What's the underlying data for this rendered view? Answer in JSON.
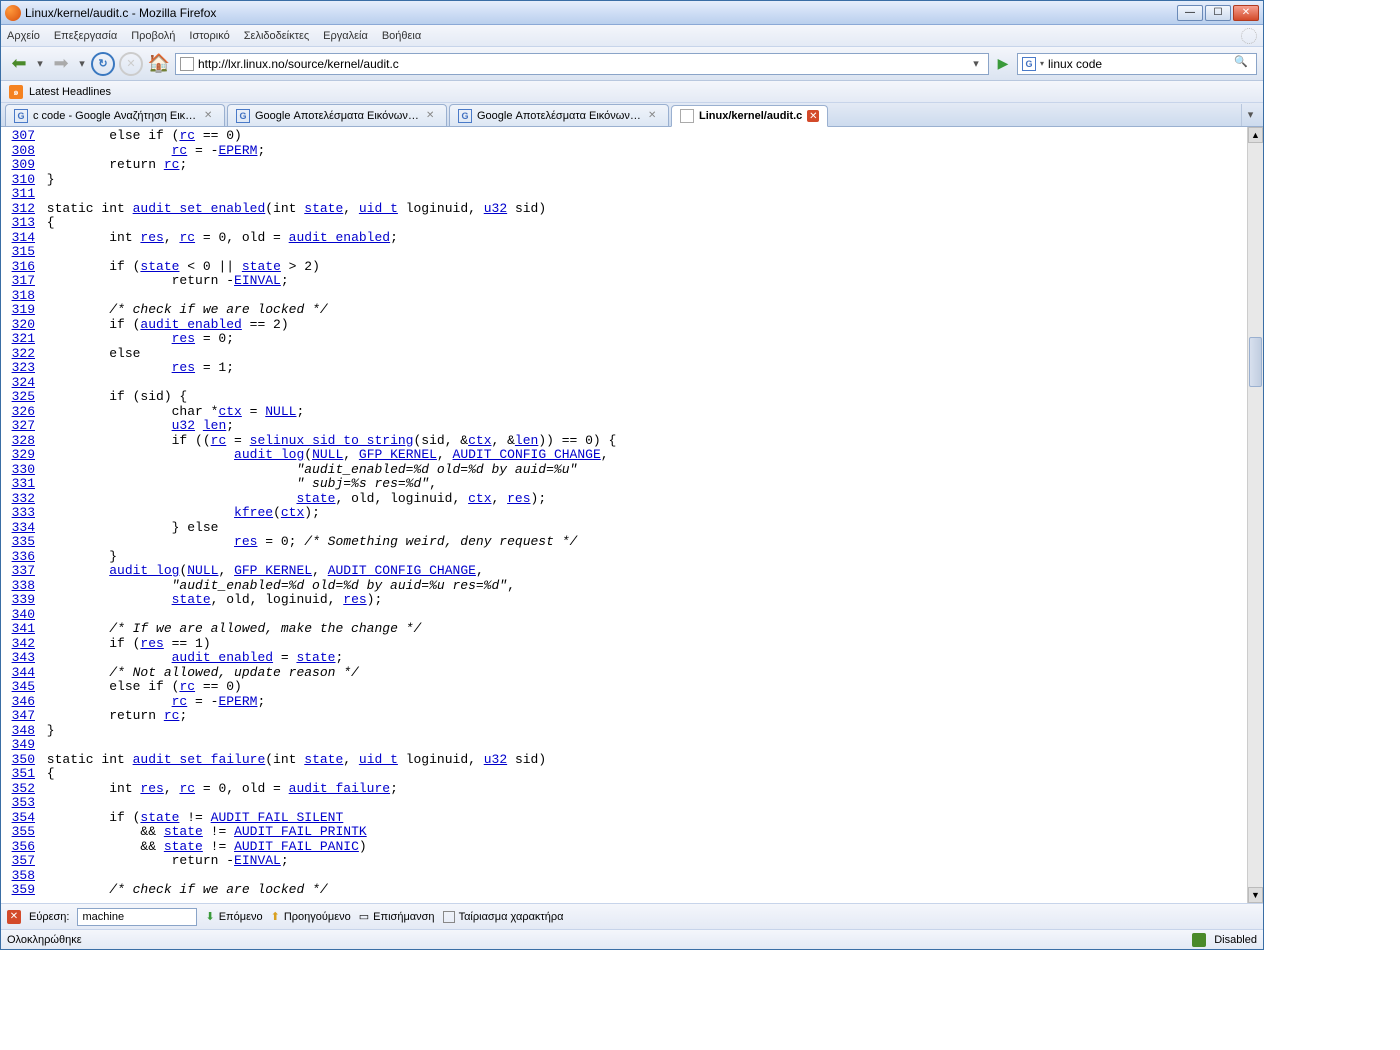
{
  "window": {
    "title": "Linux/kernel/audit.c - Mozilla Firefox"
  },
  "menubar": [
    "Αρχείο",
    "Επεξεργασία",
    "Προβολή",
    "Ιστορικό",
    "Σελιδοδείκτες",
    "Εργαλεία",
    "Βοήθεια"
  ],
  "urlbar": {
    "url": "http://lxr.linux.no/source/kernel/audit.c"
  },
  "searchbar": {
    "value": "linux code"
  },
  "bookmarkbar": {
    "latest": "Latest Headlines"
  },
  "tabs": [
    {
      "label": "c code - Google Αναζήτηση Εικόνων",
      "icon": "g",
      "active": false,
      "close": "plain"
    },
    {
      "label": "Google Αποτελέσματα Εικόνων για...",
      "icon": "g",
      "active": false,
      "close": "plain"
    },
    {
      "label": "Google Αποτελέσματα Εικόνων για...",
      "icon": "g",
      "active": false,
      "close": "plain"
    },
    {
      "label": "Linux/kernel/audit.c",
      "icon": "page",
      "active": true,
      "close": "red"
    }
  ],
  "code_lines": [
    {
      "n": "307",
      "html": "        else if (<a>rc</a> == 0)"
    },
    {
      "n": "308",
      "html": "                <a>rc</a> = -<a>EPERM</a>;"
    },
    {
      "n": "309",
      "html": "        return <a>rc</a>;"
    },
    {
      "n": "310",
      "html": "}"
    },
    {
      "n": "311",
      "html": ""
    },
    {
      "n": "312",
      "html": "static int <a>audit_set_enabled</a>(int <a>state</a>, <a>uid_t</a> loginuid, <a>u32</a> sid)"
    },
    {
      "n": "313",
      "html": "{"
    },
    {
      "n": "314",
      "html": "        int <a>res</a>, <a>rc</a> = 0, old = <a>audit_enabled</a>;"
    },
    {
      "n": "315",
      "html": ""
    },
    {
      "n": "316",
      "html": "        if (<a>state</a> &lt; 0 || <a>state</a> &gt; 2)"
    },
    {
      "n": "317",
      "html": "                return -<a>EINVAL</a>;"
    },
    {
      "n": "318",
      "html": ""
    },
    {
      "n": "319",
      "html": "        <span class=\"cmt\">/* check if we are locked */</span>"
    },
    {
      "n": "320",
      "html": "        if (<a>audit_enabled</a> == 2)"
    },
    {
      "n": "321",
      "html": "                <a>res</a> = 0;"
    },
    {
      "n": "322",
      "html": "        else"
    },
    {
      "n": "323",
      "html": "                <a>res</a> = 1;"
    },
    {
      "n": "324",
      "html": ""
    },
    {
      "n": "325",
      "html": "        if (sid) {"
    },
    {
      "n": "326",
      "html": "                char *<a>ctx</a> = <a>NULL</a>;"
    },
    {
      "n": "327",
      "html": "                <a>u32</a> <a>len</a>;"
    },
    {
      "n": "328",
      "html": "                if ((<a>rc</a> = <a>selinux_sid_to_string</a>(sid, &amp;<a>ctx</a>, &amp;<a>len</a>)) == 0) {"
    },
    {
      "n": "329",
      "html": "                        <a>audit_log</a>(<a>NULL</a>, <a>GFP_KERNEL</a>, <a>AUDIT_CONFIG_CHANGE</a>,"
    },
    {
      "n": "330",
      "html": "                                <span class=\"cmt\">\"audit_enabled=%d old=%d by auid=%u\"</span>"
    },
    {
      "n": "331",
      "html": "                                <span class=\"cmt\">\" subj=%s res=%d\"</span>,"
    },
    {
      "n": "332",
      "html": "                                <a>state</a>, old, loginuid, <a>ctx</a>, <a>res</a>);"
    },
    {
      "n": "333",
      "html": "                        <a>kfree</a>(<a>ctx</a>);"
    },
    {
      "n": "334",
      "html": "                } else"
    },
    {
      "n": "335",
      "html": "                        <a>res</a> = 0; <span class=\"cmt\">/* Something weird, deny request */</span>"
    },
    {
      "n": "336",
      "html": "        }"
    },
    {
      "n": "337",
      "html": "        <a>audit_log</a>(<a>NULL</a>, <a>GFP_KERNEL</a>, <a>AUDIT_CONFIG_CHANGE</a>,"
    },
    {
      "n": "338",
      "html": "                <span class=\"cmt\">\"audit_enabled=%d old=%d by auid=%u res=%d\"</span>,"
    },
    {
      "n": "339",
      "html": "                <a>state</a>, old, loginuid, <a>res</a>);"
    },
    {
      "n": "340",
      "html": ""
    },
    {
      "n": "341",
      "html": "        <span class=\"cmt\">/* If we are allowed, make the change */</span>"
    },
    {
      "n": "342",
      "html": "        if (<a>res</a> == 1)"
    },
    {
      "n": "343",
      "html": "                <a>audit_enabled</a> = <a>state</a>;"
    },
    {
      "n": "344",
      "html": "        <span class=\"cmt\">/* Not allowed, update reason */</span>"
    },
    {
      "n": "345",
      "html": "        else if (<a>rc</a> == 0)"
    },
    {
      "n": "346",
      "html": "                <a>rc</a> = -<a>EPERM</a>;"
    },
    {
      "n": "347",
      "html": "        return <a>rc</a>;"
    },
    {
      "n": "348",
      "html": "}"
    },
    {
      "n": "349",
      "html": ""
    },
    {
      "n": "350",
      "html": "static int <a>audit_set_failure</a>(int <a>state</a>, <a>uid_t</a> loginuid, <a>u32</a> sid)"
    },
    {
      "n": "351",
      "html": "{"
    },
    {
      "n": "352",
      "html": "        int <a>res</a>, <a>rc</a> = 0, old = <a>audit_failure</a>;"
    },
    {
      "n": "353",
      "html": ""
    },
    {
      "n": "354",
      "html": "        if (<a>state</a> != <a>AUDIT_FAIL_SILENT</a>"
    },
    {
      "n": "355",
      "html": "            &amp;&amp; <a>state</a> != <a>AUDIT_FAIL_PRINTK</a>"
    },
    {
      "n": "356",
      "html": "            &amp;&amp; <a>state</a> != <a>AUDIT_FAIL_PANIC</a>)"
    },
    {
      "n": "357",
      "html": "                return -<a>EINVAL</a>;"
    },
    {
      "n": "358",
      "html": ""
    },
    {
      "n": "359",
      "html": "        <span class=\"cmt\">/* check if we are locked */</span>"
    }
  ],
  "findbar": {
    "label": "Εύρεση:",
    "value": "machine",
    "next": "Επόμενο",
    "prev": "Προηγούμενο",
    "highlight": "Επισήμανση",
    "matchcase": "Ταίριασμα χαρακτήρα"
  },
  "statusbar": {
    "text": "Ολοκληρώθηκε",
    "disabled": "Disabled"
  }
}
